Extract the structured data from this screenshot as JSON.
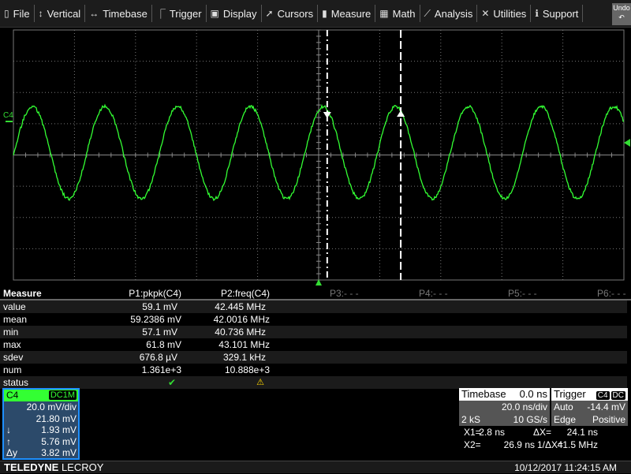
{
  "menu": [
    {
      "label": "File",
      "icon": "file-icon",
      "glyph": "▯"
    },
    {
      "label": "Vertical",
      "icon": "vertical-arrows-icon",
      "glyph": "↕"
    },
    {
      "label": "Timebase",
      "icon": "horizontal-arrows-icon",
      "glyph": "↔"
    },
    {
      "label": "Trigger",
      "icon": "trigger-icon",
      "glyph": "⎾"
    },
    {
      "label": "Display",
      "icon": "display-icon",
      "glyph": "▣"
    },
    {
      "label": "Cursors",
      "icon": "cursor-icon",
      "glyph": "➚"
    },
    {
      "label": "Measure",
      "icon": "ruler-icon",
      "glyph": "▮"
    },
    {
      "label": "Math",
      "icon": "calculator-icon",
      "glyph": "▦"
    },
    {
      "label": "Analysis",
      "icon": "chart-icon",
      "glyph": "⟋"
    },
    {
      "label": "Utilities",
      "icon": "tools-icon",
      "glyph": "✕"
    },
    {
      "label": "Support",
      "icon": "info-icon",
      "glyph": "ℹ"
    }
  ],
  "undo": {
    "label": "Undo",
    "glyph": "↶"
  },
  "trace": {
    "label": "C4",
    "color": "#33ff33",
    "frequency_mhz": 42.0,
    "pkpk_mv": 59.1
  },
  "measure": {
    "header": "Measure",
    "columns": [
      "P1:pkpk(C4)",
      "P2:freq(C4)"
    ],
    "placeholders": [
      "P3:- - -",
      "P4:- - -",
      "P5:- - -",
      "P6:- - -"
    ],
    "rows": [
      {
        "label": "value",
        "p1": "59.1 mV",
        "p2": "42.445 MHz"
      },
      {
        "label": "mean",
        "p1": "59.2386 mV",
        "p2": "42.0016 MHz"
      },
      {
        "label": "min",
        "p1": "57.1 mV",
        "p2": "40.736 MHz"
      },
      {
        "label": "max",
        "p1": "61.8 mV",
        "p2": "43.101 MHz"
      },
      {
        "label": "sdev",
        "p1": "676.8 µV",
        "p2": "329.1 kHz"
      },
      {
        "label": "num",
        "p1": "1.361e+3",
        "p2": "10.888e+3"
      },
      {
        "label": "status",
        "p1": "✔",
        "p2": "⚠"
      }
    ]
  },
  "channel": {
    "name": "C4",
    "coupling": "DC1M",
    "vdiv": "20.0 mV/div",
    "offset": "21.80 mV",
    "rows": [
      {
        "k": "↓",
        "v": "1.93 mV"
      },
      {
        "k": "↑",
        "v": "5.76 mV"
      },
      {
        "k": "Δy",
        "v": "3.82 mV"
      }
    ]
  },
  "timebase": {
    "title": "Timebase",
    "delay": "0.0 ns",
    "tdiv": "20.0 ns/div",
    "samples": "2 kS",
    "rate": "10 GS/s"
  },
  "trigger": {
    "title": "Trigger",
    "source": "C4",
    "coupling": "DC",
    "mode": "Auto",
    "level": "-14.4 mV",
    "type": "Edge",
    "slope": "Positive"
  },
  "cursors": {
    "x1_label": "X1=",
    "x1": "2.8 ns",
    "dx_label": "ΔX=",
    "dx": "24.1 ns",
    "x2_label": "X2=",
    "x2": "26.9 ns",
    "inv_label": "1/ΔX=",
    "inv": "41.5 MHz",
    "x1_ns": 2.8,
    "x2_ns": 26.9
  },
  "footer": {
    "brand_a": "TELEDYNE",
    "brand_b": " LECROY",
    "datetime": "10/12/2017 11:24:15 AM"
  }
}
